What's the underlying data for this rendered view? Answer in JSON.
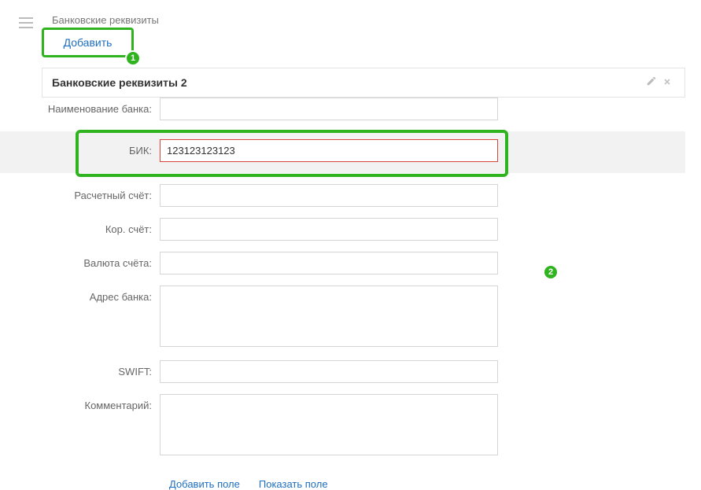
{
  "page": {
    "title": "Банковские реквизиты"
  },
  "add_button": {
    "label": "Добавить"
  },
  "badges": {
    "b1": "1",
    "b2": "2"
  },
  "section": {
    "title": "Банковские реквизиты 2"
  },
  "fields": {
    "bank_name": {
      "label": "Наименование банка:",
      "value": ""
    },
    "bik": {
      "label": "БИК:",
      "value": "123123123123"
    },
    "account": {
      "label": "Расчетный счёт:",
      "value": ""
    },
    "corr": {
      "label": "Кор. счёт:",
      "value": ""
    },
    "currency": {
      "label": "Валюта счёта:",
      "value": ""
    },
    "address": {
      "label": "Адрес банка:",
      "value": ""
    },
    "swift": {
      "label": "SWIFT:",
      "value": ""
    },
    "comment": {
      "label": "Комментарий:",
      "value": ""
    }
  },
  "bottom": {
    "add_field": "Добавить поле",
    "show_field": "Показать поле"
  }
}
